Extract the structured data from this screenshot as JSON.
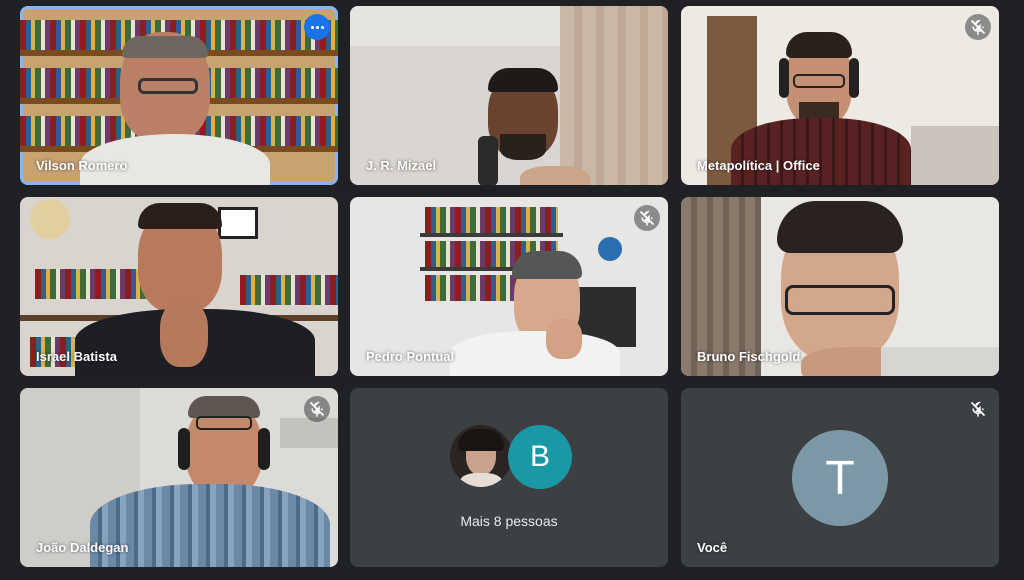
{
  "tiles": [
    {
      "name": "Vilson Romero",
      "muted": false,
      "active": true
    },
    {
      "name": "J. R. Mizael",
      "muted": false
    },
    {
      "name": "Metapolítica | Office",
      "muted": true
    },
    {
      "name": "Israel Batista",
      "muted": false
    },
    {
      "name": "Pedro Pontual",
      "muted": true
    },
    {
      "name": "Bruno Fischgold",
      "muted": false
    },
    {
      "name": "João Daldegan",
      "muted": true
    }
  ],
  "more_people": {
    "label": "Mais 8 pessoas",
    "avatar_letter": "B",
    "avatar_color": "#1b98a6"
  },
  "self": {
    "name": "Você",
    "letter": "T",
    "avatar_color": "#7c98a6",
    "muted": true
  },
  "colors": {
    "background": "#202124",
    "tile": "#3c4043",
    "active_border": "#8ab4f8",
    "more_button": "#1a73e8"
  }
}
